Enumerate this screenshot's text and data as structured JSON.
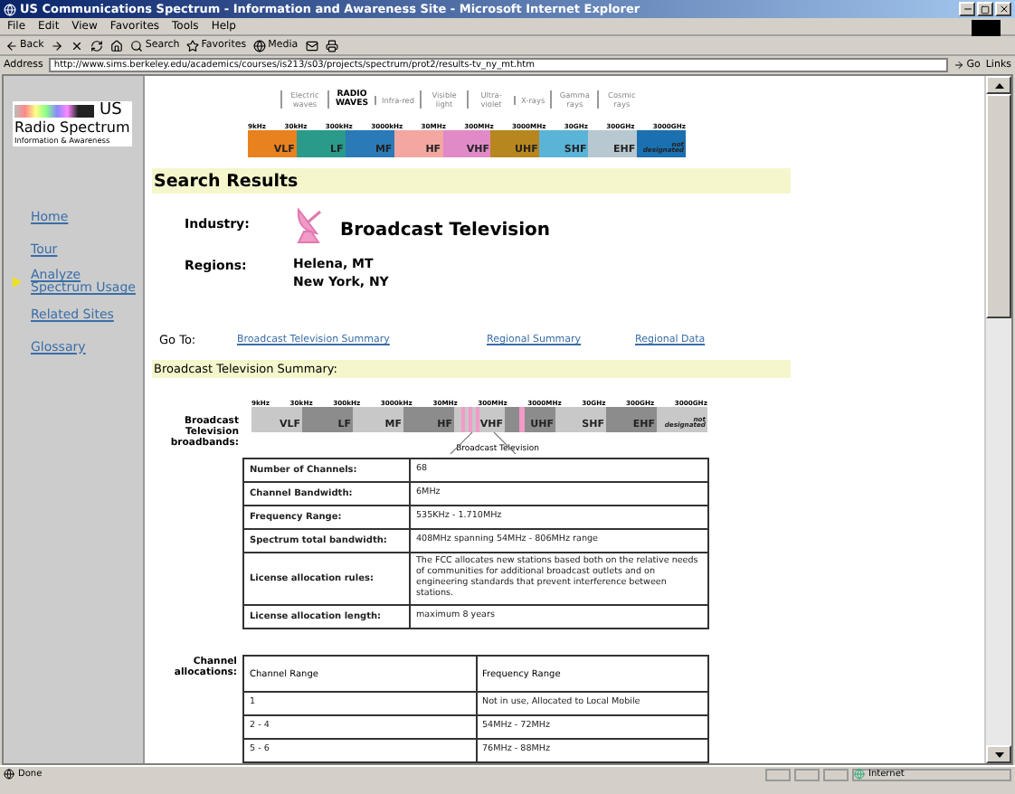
{
  "window": {
    "title": "US Communications Spectrum - Information and Awareness Site - Microsoft Internet Explorer"
  },
  "menu": [
    "File",
    "Edit",
    "View",
    "Favorites",
    "Tools",
    "Help"
  ],
  "toolbar": [
    "Back",
    "Search",
    "Favorites",
    "Media"
  ],
  "address": {
    "label": "Address",
    "url": "http://www.sims.berkeley.edu/academics/courses/is213/s03/projects/spectrum/prot2/results-tv_ny_mt.htm",
    "go": "Go",
    "links": "Links"
  },
  "logo": {
    "mark": "US",
    "name": "Radio Spectrum",
    "tagline": "Information & Awareness"
  },
  "sidebar": {
    "items": [
      {
        "label": "Home",
        "selected": false
      },
      {
        "label": "Tour",
        "selected": false
      },
      {
        "label": "Analyze Spectrum Usage",
        "selected": true
      },
      {
        "label": "Related Sites",
        "selected": false
      },
      {
        "label": "Glossary",
        "selected": false
      }
    ]
  },
  "spectrum_header": {
    "bands": [
      {
        "label": "Electric waves",
        "selected": false
      },
      {
        "label": "RADIO WAVES",
        "selected": true
      },
      {
        "label": "Infra-red",
        "selected": false
      },
      {
        "label": "Visible light",
        "selected": false
      },
      {
        "label": "Ultra-violet",
        "selected": false
      },
      {
        "label": "X-rays",
        "selected": false
      },
      {
        "label": "Gamma rays",
        "selected": false
      },
      {
        "label": "Cosmic rays",
        "selected": false
      }
    ],
    "frequencies": [
      "9kHz",
      "30kHz",
      "300kHz",
      "3000kHz",
      "30MHz",
      "300MHz",
      "3000MHz",
      "30GHz",
      "300GHz",
      "3000GHz"
    ],
    "segments": [
      {
        "label": "VLF",
        "color": "#e8821e"
      },
      {
        "label": "LF",
        "color": "#2a9a8a"
      },
      {
        "label": "MF",
        "color": "#2a7ab8"
      },
      {
        "label": "HF",
        "color": "#f4a6a0"
      },
      {
        "label": "VHF",
        "color": "#e08ac8"
      },
      {
        "label": "UHF",
        "color": "#b8861e"
      },
      {
        "label": "SHF",
        "color": "#5ab4d8"
      },
      {
        "label": "EHF",
        "color": "#b8c8d0"
      },
      {
        "label": "not designated",
        "color": "#1a70b0"
      }
    ]
  },
  "results": {
    "title": "Search Results",
    "industry_label": "Industry:",
    "industry": "Broadcast Television",
    "regions_label": "Regions:",
    "regions": [
      "Helena, MT",
      "New York, NY"
    ],
    "goto_label": "Go To:",
    "goto_links": [
      "Broadcast Television Summary",
      "Regional Summary",
      "Regional Data"
    ]
  },
  "summary": {
    "title": "Broadcast Television Summary:",
    "broadbands_label": "Broadcast Television broadbands:",
    "frequencies": [
      "9kHz",
      "30kHz",
      "300kHz",
      "3000kHz",
      "30MHz",
      "300MHz",
      "3000MHz",
      "30GHz",
      "300GHz",
      "3000GHz"
    ],
    "segments": [
      {
        "label": "VLF",
        "color": "#c8c8c8"
      },
      {
        "label": "LF",
        "color": "#8c8c8c"
      },
      {
        "label": "MF",
        "color": "#c8c8c8"
      },
      {
        "label": "HF",
        "color": "#8c8c8c"
      },
      {
        "label": "VHF",
        "color": "#c8c8c8"
      },
      {
        "label": "UHF",
        "color": "#8c8c8c"
      },
      {
        "label": "SHF",
        "color": "#c8c8c8"
      },
      {
        "label": "EHF",
        "color": "#8c8c8c"
      },
      {
        "label": "not designated",
        "color": "#c8c8c8"
      }
    ],
    "caption": "Broadcast Television",
    "rows": [
      {
        "label": "Number of Channels:",
        "value": "68"
      },
      {
        "label": "Channel Bandwidth:",
        "value": "6MHz"
      },
      {
        "label": "Frequency Range:",
        "value": "535KHz - 1.710MHz"
      },
      {
        "label": "Spectrum total bandwidth:",
        "value": "408MHz spanning 54MHz - 806MHz range"
      },
      {
        "label": "License allocation rules:",
        "value": "The FCC allocates new stations based both on the relative needs of communities for additional broadcast outlets and on engineering standards that prevent interference between stations."
      },
      {
        "label": "License allocation length:",
        "value": "maximum 8 years"
      }
    ]
  },
  "allocations": {
    "label": "Channel allocations:",
    "columns": [
      "Channel Range",
      "Frequency Range"
    ],
    "rows": [
      [
        "1",
        "Not in use, Allocated to Local Mobile"
      ],
      [
        "2 - 4",
        "54MHz - 72MHz"
      ],
      [
        "5 - 6",
        "76MHz - 88MHz"
      ]
    ]
  },
  "status_bar": {
    "text": "Done",
    "zone": "Internet"
  }
}
